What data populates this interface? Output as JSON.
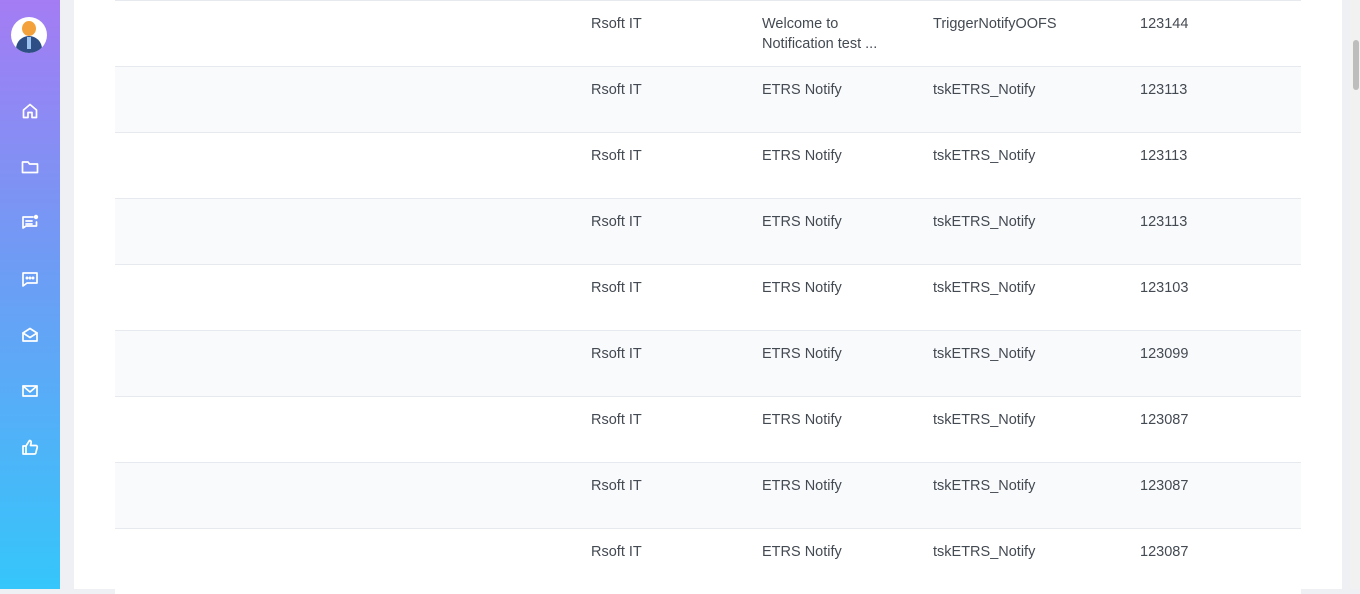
{
  "sidebar": {
    "items": [
      {
        "icon": "home-icon"
      },
      {
        "icon": "folder-icon"
      },
      {
        "icon": "notifications-icon"
      },
      {
        "icon": "chat-icon"
      },
      {
        "icon": "mail-open-icon"
      },
      {
        "icon": "mail-icon"
      },
      {
        "icon": "thumbs-up-icon"
      }
    ]
  },
  "table": {
    "rows": [
      {
        "org": "Rsoft IT",
        "subject": "Welcome to\nNotification test ...",
        "trigger": "TriggerNotifyOOFS",
        "id": "123144"
      },
      {
        "org": "Rsoft IT",
        "subject": "ETRS Notify",
        "trigger": "tskETRS_Notify",
        "id": "123113"
      },
      {
        "org": "Rsoft IT",
        "subject": "ETRS Notify",
        "trigger": "tskETRS_Notify",
        "id": "123113"
      },
      {
        "org": "Rsoft IT",
        "subject": "ETRS Notify",
        "trigger": "tskETRS_Notify",
        "id": "123113"
      },
      {
        "org": "Rsoft IT",
        "subject": "ETRS Notify",
        "trigger": "tskETRS_Notify",
        "id": "123103"
      },
      {
        "org": "Rsoft IT",
        "subject": "ETRS Notify",
        "trigger": "tskETRS_Notify",
        "id": "123099"
      },
      {
        "org": "Rsoft IT",
        "subject": "ETRS Notify",
        "trigger": "tskETRS_Notify",
        "id": "123087"
      },
      {
        "org": "Rsoft IT",
        "subject": "ETRS Notify",
        "trigger": "tskETRS_Notify",
        "id": "123087"
      },
      {
        "org": "Rsoft IT",
        "subject": "ETRS Notify",
        "trigger": "tskETRS_Notify",
        "id": "123087"
      }
    ]
  },
  "colors": {
    "sidebar_top": "#a47cf3",
    "sidebar_bottom": "#35c6fb",
    "row_alt": "#f9fafc",
    "text": "#444a52"
  }
}
